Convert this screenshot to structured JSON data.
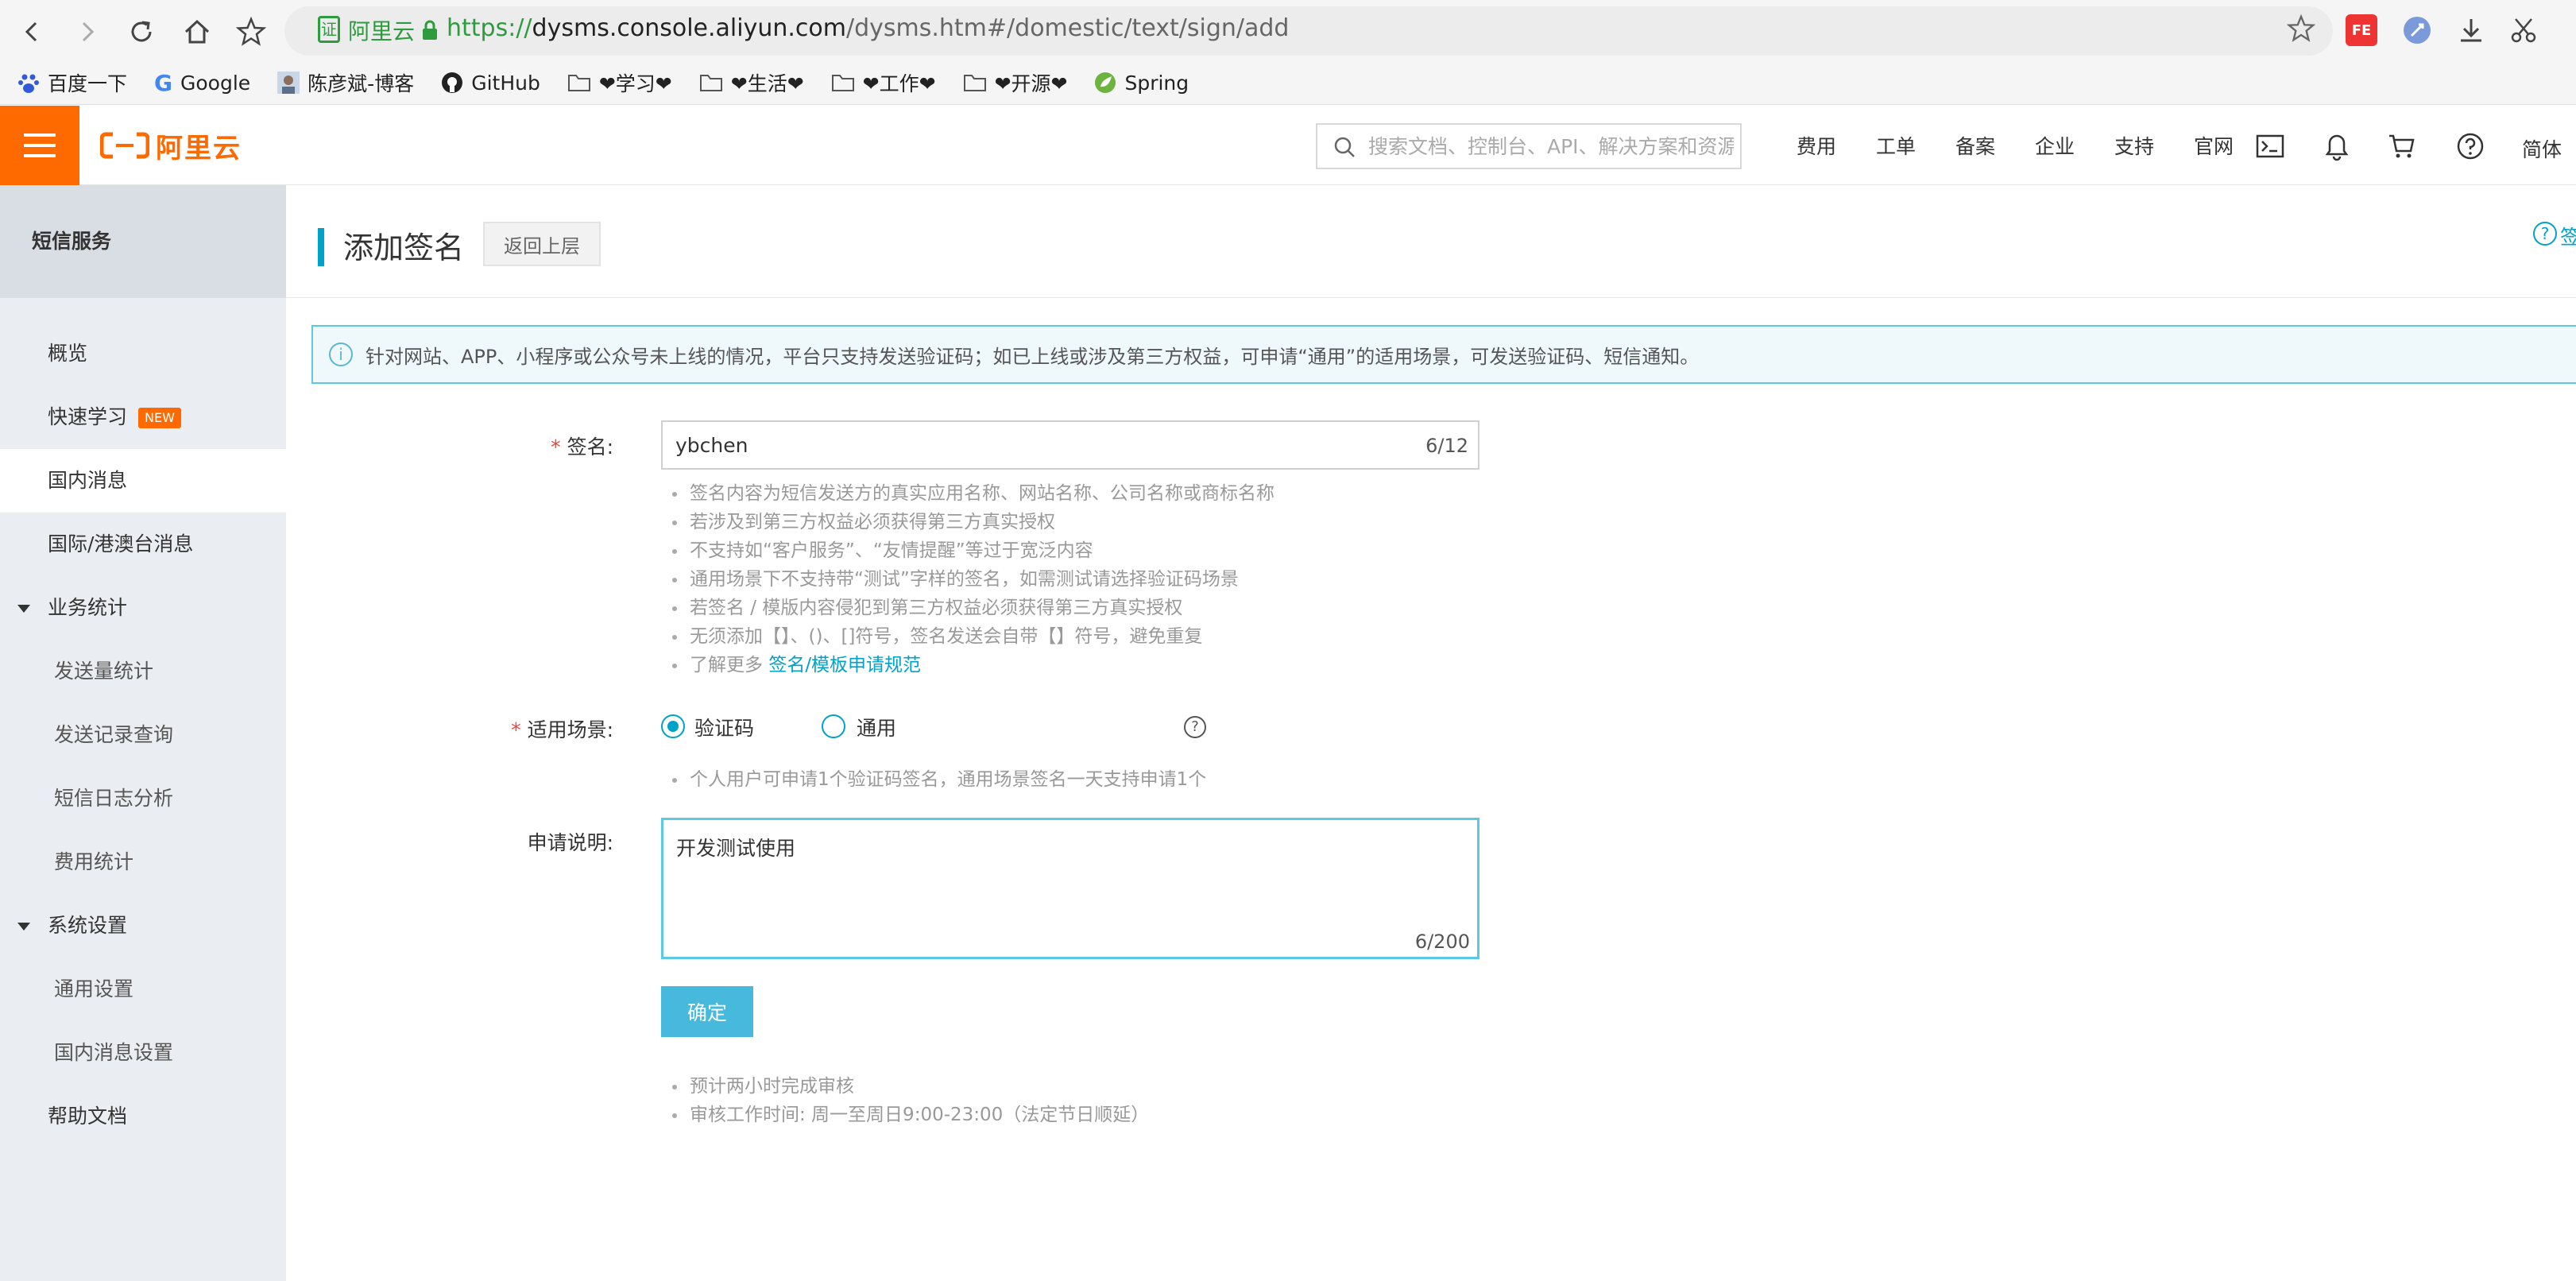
{
  "browser": {
    "url_scheme": "https://",
    "url_host": "dysms.console.aliyun.com",
    "url_path": "/dysms.htm#/domestic/text/sign/add",
    "cert_icon": "证",
    "cert_label": "阿里云",
    "bookmarks": [
      {
        "label": "百度一下",
        "icon": "baidu-icon"
      },
      {
        "label": "Google",
        "icon": "google-icon"
      },
      {
        "label": "陈彦斌-博客",
        "icon": "avatar-icon"
      },
      {
        "label": "GitHub",
        "icon": "github-icon"
      },
      {
        "label": "❤学习❤",
        "icon": "folder-icon"
      },
      {
        "label": "❤生活❤",
        "icon": "folder-icon"
      },
      {
        "label": "❤工作❤",
        "icon": "folder-icon"
      },
      {
        "label": "❤开源❤",
        "icon": "folder-icon"
      },
      {
        "label": "Spring",
        "icon": "spring-icon"
      }
    ],
    "ext_fe_label": "FE"
  },
  "topbar": {
    "logo_text": "阿里云",
    "search_placeholder": "搜索文档、控制台、API、解决方案和资源",
    "nav": [
      "费用",
      "工单",
      "备案",
      "企业",
      "支持",
      "官网"
    ],
    "lang": "简体"
  },
  "sidebar": {
    "title": "短信服务",
    "items": [
      {
        "label": "概览"
      },
      {
        "label": "快速学习",
        "badge": "NEW"
      },
      {
        "label": "国内消息"
      },
      {
        "label": "国际/港澳台消息"
      },
      {
        "label": "业务统计"
      },
      {
        "label": "发送量统计"
      },
      {
        "label": "发送记录查询"
      },
      {
        "label": "短信日志分析"
      },
      {
        "label": "费用统计"
      },
      {
        "label": "系统设置"
      },
      {
        "label": "通用设置"
      },
      {
        "label": "国内消息设置"
      },
      {
        "label": "帮助文档"
      }
    ]
  },
  "page": {
    "title": "添加签名",
    "back_label": "返回上层",
    "help_label": "签",
    "notice": "针对网站、APP、小程序或公众号未上线的情况，平台只支持发送验证码；如已上线或涉及第三方权益，可申请“通用”的适用场景，可发送验证码、短信通知。"
  },
  "form": {
    "sig_label": "签名:",
    "sig_value": "ybchen",
    "sig_count": "6/12",
    "sig_hints": [
      "签名内容为短信发送方的真实应用名称、网站名称、公司名称或商标名称",
      "若涉及到第三方权益必须获得第三方真实授权",
      "不支持如“客户服务”、“友情提醒”等过于宽泛内容",
      "通用场景下不支持带“测试”字样的签名，如需测试请选择验证码场景",
      "若签名 / 模版内容侵犯到第三方权益必须获得第三方真实授权",
      "无须添加【】、()、[]符号，签名发送会自带【】符号，避免重复"
    ],
    "sig_more_prefix": "了解更多 ",
    "sig_more_link": "签名/模板申请规范",
    "scene_label": "适用场景:",
    "scene_options": [
      "验证码",
      "通用"
    ],
    "scene_selected": "验证码",
    "scene_hint": "个人用户可申请1个验证码签名，通用场景签名一天支持申请1个",
    "desc_label": "申请说明:",
    "desc_value": "开发测试使用",
    "desc_count": "6/200",
    "submit_label": "确定",
    "footer_hints": [
      "预计两小时完成审核",
      "审核工作时间: 周一至周日9:00-23:00（法定节日顺延）"
    ]
  },
  "colors": {
    "brand_orange": "#ff6a00",
    "accent_blue": "#00a2ca",
    "notice_border": "#5bc9e3",
    "button_blue": "#46b9dc",
    "secure_green": "#2e9b3f"
  }
}
